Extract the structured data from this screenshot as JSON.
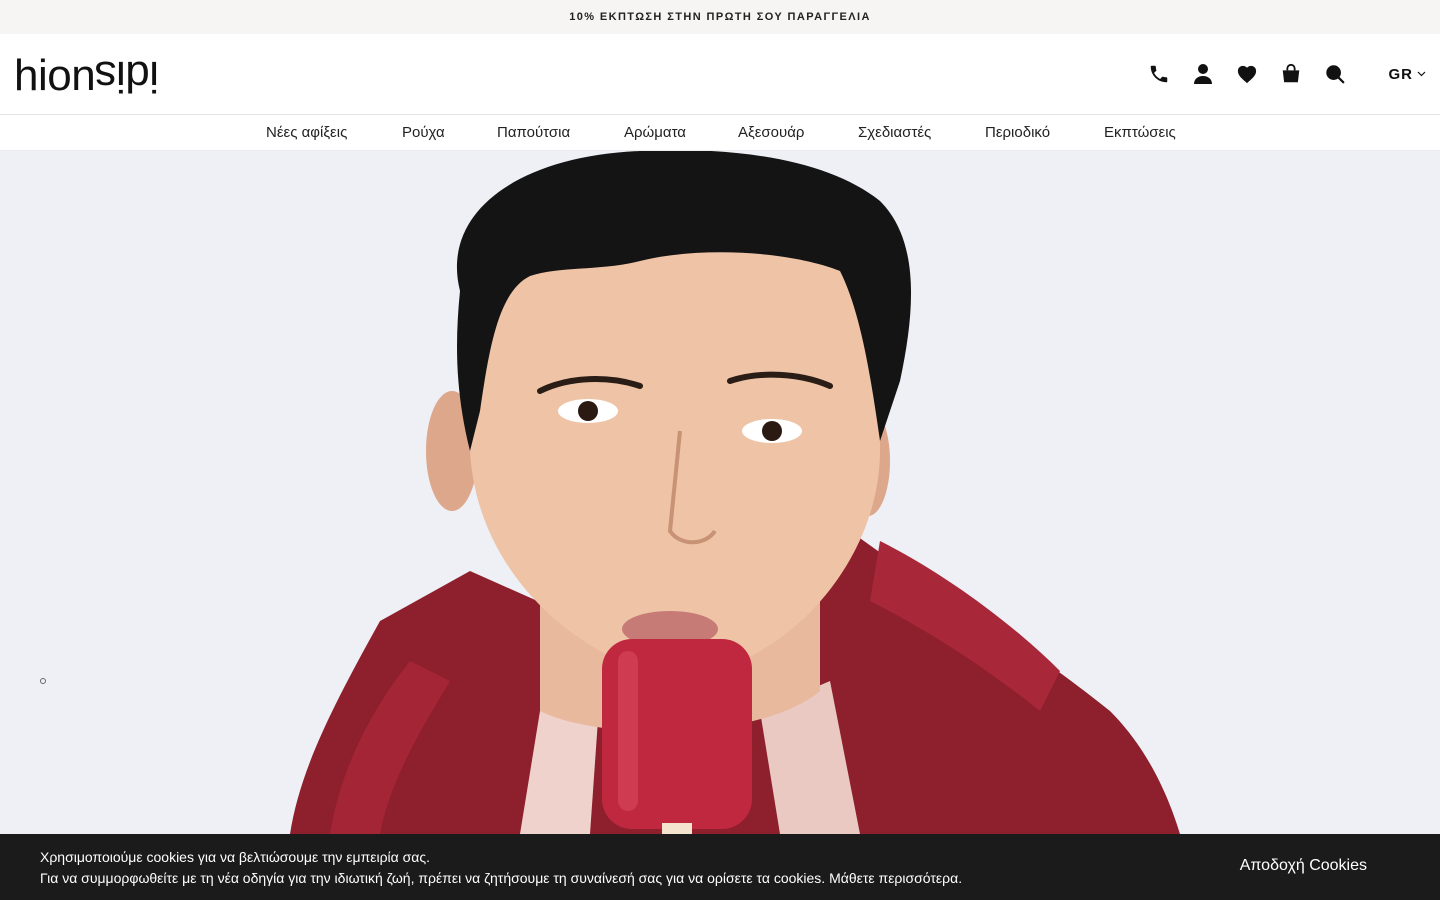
{
  "promo": {
    "text": "10% ΕΚΠΤΩΣΗ ΣΤΗΝ ΠΡΩΤΗ ΣΟΥ ΠΑΡΑΓΓΕΛΙΑ"
  },
  "header": {
    "logo": {
      "part1": "hion",
      "part2": "idis"
    },
    "icons": [
      "phone-icon",
      "account-icon",
      "wishlist-heart-icon",
      "shopping-bag-icon",
      "search-icon"
    ],
    "language": "GR"
  },
  "nav": {
    "items": [
      {
        "label": "Νέες αφίξεις"
      },
      {
        "label": "Ρούχα"
      },
      {
        "label": "Παπούτσια"
      },
      {
        "label": "Αρώματα"
      },
      {
        "label": "Αξεσουάρ"
      },
      {
        "label": "Σχεδιαστές"
      },
      {
        "label": "Περιοδικό"
      },
      {
        "label": "Εκπτώσεις"
      }
    ]
  },
  "cookie": {
    "line1": "Χρησιμοποιούμε cookies για να βελτιώσουμε την εμπειρία σας.",
    "line2": "Για να συμμορφωθείτε με τη νέα οδηγία για την ιδιωτική ζωή, πρέπει να ζητήσουμε τη συναίνεσή σας για να ορίσετε τα cookies. Μάθετε περισσότερα.",
    "accept": "Αποδοχή Cookies"
  },
  "colors": {
    "promo_bg": "#f6f5f3",
    "hero_bg": "#eef0f5",
    "jacket": "#8e1f2c",
    "popsicle": "#c0283f",
    "cookie_bg": "#1c1b1b"
  }
}
